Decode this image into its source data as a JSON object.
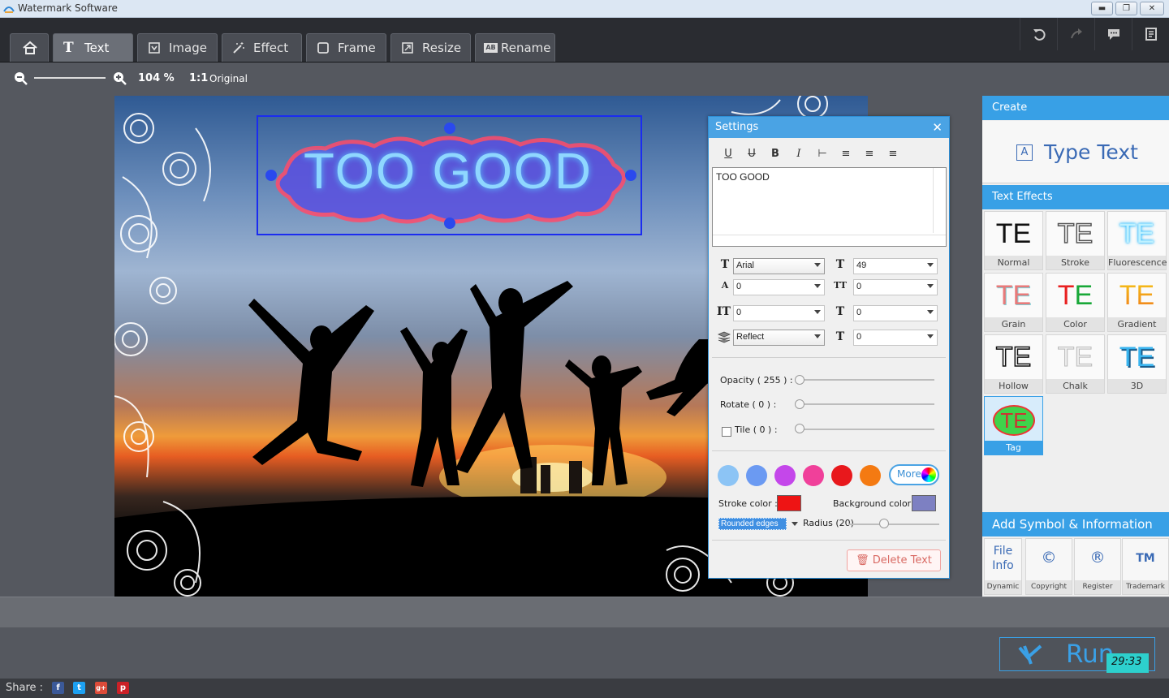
{
  "window": {
    "title": "Watermark Software"
  },
  "toolbar": {
    "tabs": [
      {
        "label": ""
      },
      {
        "label": "Text"
      },
      {
        "label": "Image"
      },
      {
        "label": "Effect"
      },
      {
        "label": "Frame"
      },
      {
        "label": "Resize"
      },
      {
        "label": "Rename"
      }
    ]
  },
  "zoom": {
    "value": "104 %",
    "original_icon": "1:1",
    "original_label": "Original"
  },
  "watermark": {
    "text": "TOO GOOD"
  },
  "settings": {
    "title": "Settings",
    "text_value": "TOO GOOD",
    "font": "Arial",
    "size": "49",
    "f1": "0",
    "f2": "0",
    "f3": "0",
    "f4": "0",
    "effect": "Reflect",
    "f5": "0",
    "opacity_label": "Opacity ( 255 ) :",
    "rotate_label": "Rotate ( 0 ) :",
    "tile_label": "Tile ( 0 ) :",
    "more_label": "More",
    "stroke_label": "Stroke color :",
    "background_label": "Background color :",
    "edge_value": "Rounded edges",
    "radius_label": "Radius (20)",
    "delete_label": "Delete Text",
    "swatches": [
      "#8cc4f5",
      "#6b9af2",
      "#c447ea",
      "#f0409a",
      "#e8181c",
      "#f47a12"
    ],
    "stroke_color": "#ee1414",
    "background_color": "#7d80c2"
  },
  "right_panel": {
    "create_label": "Create",
    "type_text_label": "Type Text",
    "effects_label": "Text Effects",
    "effects": [
      {
        "glyph": "TE",
        "label": "Normal"
      },
      {
        "glyph": "TE",
        "label": "Stroke"
      },
      {
        "glyph": "TE",
        "label": "Fluorescence"
      },
      {
        "glyph": "TE",
        "label": "Grain"
      },
      {
        "glyph": "TE",
        "label": "Color"
      },
      {
        "glyph": "TE",
        "label": "Gradient"
      },
      {
        "glyph": "TE",
        "label": "Hollow"
      },
      {
        "glyph": "TE",
        "label": "Chalk"
      },
      {
        "glyph": "TE",
        "label": "3D"
      },
      {
        "glyph": "TE",
        "label": "Tag"
      }
    ],
    "symbol_label": "Add Symbol & Information",
    "symbols": [
      {
        "glyph": "File Info",
        "label": "Dynamic"
      },
      {
        "glyph": "©",
        "label": "Copyright"
      },
      {
        "glyph": "®",
        "label": "Register"
      },
      {
        "glyph": "TM",
        "label": "Trademark"
      }
    ]
  },
  "run": {
    "label": "Run",
    "clock": "29:33"
  },
  "share": {
    "label": "Share :",
    "networks": [
      "f",
      "t",
      "g+",
      "p"
    ]
  }
}
